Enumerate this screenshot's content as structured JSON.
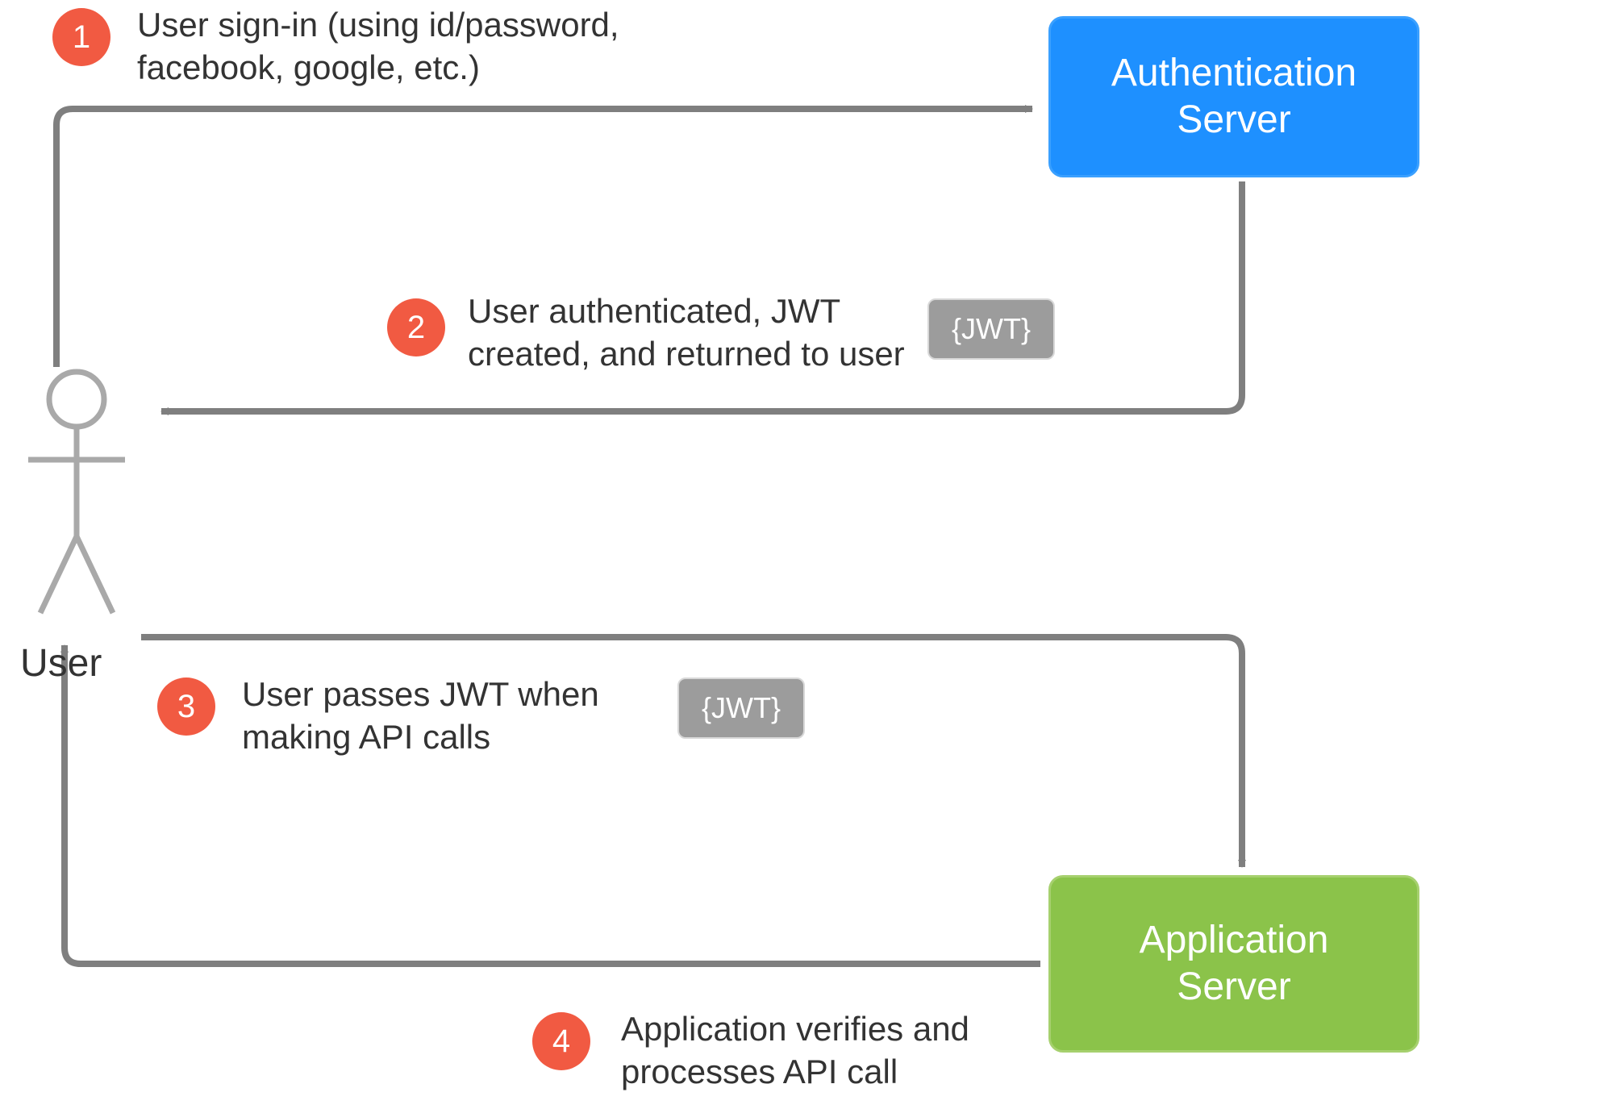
{
  "actors": {
    "user_label": "User",
    "auth_server_label": "Authentication\nServer",
    "app_server_label": "Application\nServer"
  },
  "tokens": {
    "jwt_auth": "{JWT}",
    "jwt_api": "{JWT}"
  },
  "steps": {
    "s1": {
      "num": "1",
      "text": "User sign-in (using id/password,\nfacebook, google, etc.)"
    },
    "s2": {
      "num": "2",
      "text": "User authenticated, JWT\ncreated, and returned to user"
    },
    "s3": {
      "num": "3",
      "text": "User passes JWT when\nmaking API calls"
    },
    "s4": {
      "num": "4",
      "text": "Application verifies and\nprocesses API call"
    }
  },
  "colors": {
    "badge": "#f15a42",
    "auth": "#1e90ff",
    "app": "#8bc34a",
    "jwt": "#9c9c9c",
    "arrow": "#7f7f7f",
    "stick": "#a9a9a9"
  }
}
